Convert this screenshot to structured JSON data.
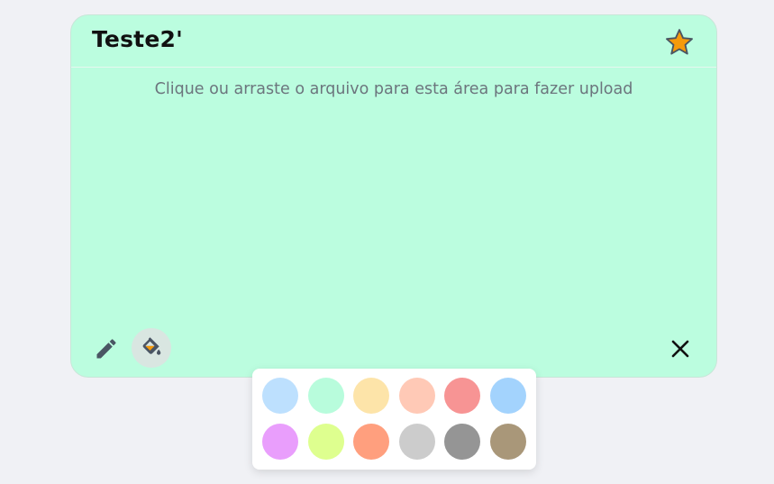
{
  "card": {
    "title": "Teste2'",
    "upload_hint": "Clique ou arraste o arquivo para esta área para fazer upload",
    "background_color": "#bbfddf",
    "favorite": true
  },
  "icons": {
    "favorite": "star-icon",
    "edit": "pencil-icon",
    "fill": "paint-bucket-icon",
    "close": "close-icon"
  },
  "palette": {
    "colors": [
      "#bde0fe",
      "#b8fcdc",
      "#fde4a9",
      "#ffc9b6",
      "#f79494",
      "#a3d3fd",
      "#e99efc",
      "#deff8f",
      "#ff9f7e",
      "#cccccc",
      "#959595",
      "#a99779"
    ]
  },
  "accent": {
    "star_fill": "#f59a0b",
    "icon_color": "#4a5563"
  }
}
